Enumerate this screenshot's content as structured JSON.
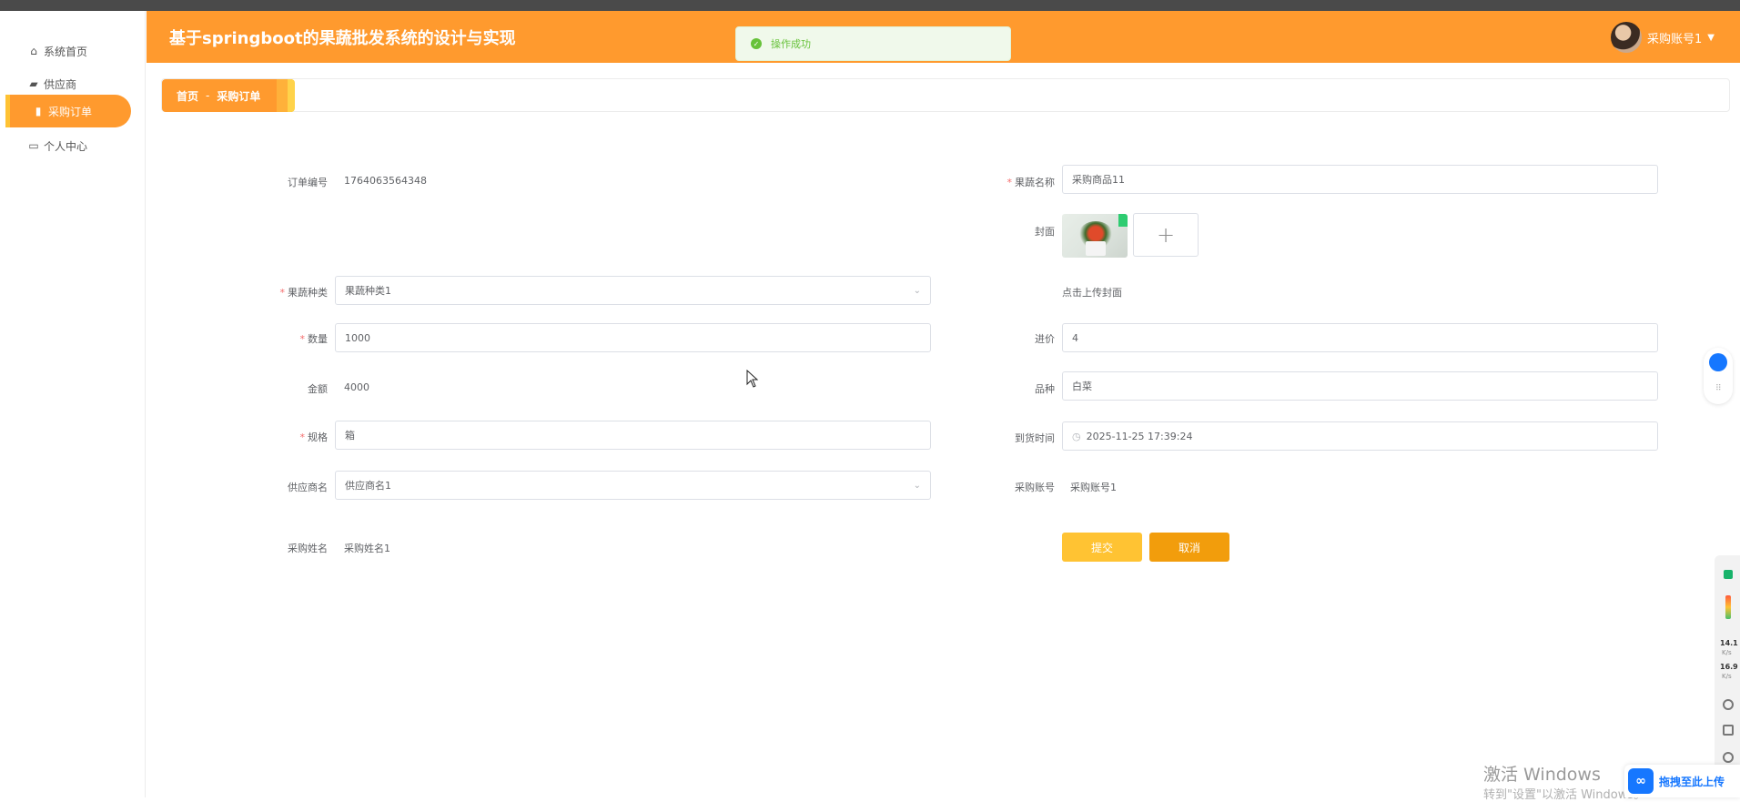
{
  "app": {
    "title": "基于springboot的果蔬批发系统的设计与实现"
  },
  "user": {
    "name": "采购账号1"
  },
  "toast": {
    "message": "操作成功"
  },
  "sidebar": {
    "items": [
      {
        "label": "系统首页",
        "icon": "home-icon"
      },
      {
        "label": "供应商",
        "icon": "briefcase-icon"
      },
      {
        "label": "采购订单",
        "icon": "order-icon",
        "active": true
      },
      {
        "label": "个人中心",
        "icon": "profile-icon"
      }
    ]
  },
  "breadcrumb": {
    "home": "首页",
    "separator": "-",
    "current": "采购订单"
  },
  "form": {
    "order_no": {
      "label": "订单编号",
      "value": "1764063564348"
    },
    "product_name": {
      "label": "果蔬名称",
      "value": "采购商品11"
    },
    "cover": {
      "label": "封面",
      "hint": "点击上传封面"
    },
    "category": {
      "label": "果蔬种类",
      "value": "果蔬种类1"
    },
    "quantity": {
      "label": "数量",
      "value": "1000"
    },
    "price": {
      "label": "进价",
      "value": "4"
    },
    "amount": {
      "label": "金额",
      "value": "4000"
    },
    "variety": {
      "label": "品种",
      "value": "白菜"
    },
    "spec": {
      "label": "规格",
      "value": "箱"
    },
    "arrival_time": {
      "label": "到货时间",
      "value": "2025-11-25 17:39:24"
    },
    "supplier_name": {
      "label": "供应商名",
      "value": "供应商名1"
    },
    "purchase_account": {
      "label": "采购账号",
      "value": "采购账号1"
    },
    "purchase_name": {
      "label": "采购姓名",
      "value": "采购姓名1"
    },
    "required_mark": "*"
  },
  "buttons": {
    "submit": "提交",
    "cancel": "取消"
  },
  "sys_panel": {
    "up_speed": "14.1",
    "up_unit": "K/s",
    "down_speed": "16.9",
    "down_unit": "K/s"
  },
  "watermark": {
    "line1": "激活 Windows",
    "line2": "转到\"设置\"以激活 Windows。"
  },
  "upload_drop": {
    "label": "拖拽至此上传"
  },
  "colors": {
    "accent": "#ff9a2e",
    "submit": "#ffc333",
    "cancel": "#f29d0c",
    "success": "#67c23a"
  }
}
